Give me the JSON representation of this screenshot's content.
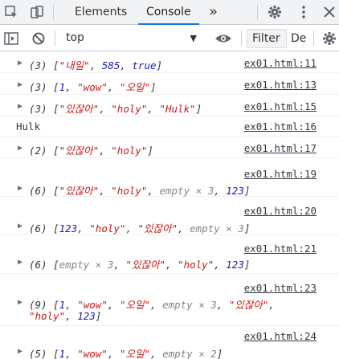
{
  "tabbar": {
    "tabs": [
      "Elements",
      "Console"
    ],
    "active_tab": "Console",
    "more_label": "»"
  },
  "toolbar": {
    "context": "top",
    "filter_placeholder": "Filter",
    "levels_label": "De"
  },
  "messages": [
    {
      "source": "ex01.html:11",
      "count": "(3)",
      "parts": [
        "[",
        "\"내일\"",
        ", ",
        "585",
        ", ",
        "true",
        "]"
      ]
    },
    {
      "source": "ex01.html:13",
      "count": "(3)",
      "parts": [
        "[",
        "1",
        ", ",
        "\"wow\"",
        ", ",
        "\"오일\"",
        "]"
      ]
    },
    {
      "source": "ex01.html:15",
      "count": "(3)",
      "parts": [
        "[",
        "\"있잖아\"",
        ", ",
        "\"holy\"",
        ", ",
        "\"Hulk\"",
        "]"
      ]
    },
    {
      "source": "ex01.html:16",
      "text": "Hulk"
    },
    {
      "source": "ex01.html:17",
      "count": "(2)",
      "parts": [
        "[",
        "\"있잖아\"",
        ", ",
        "\"holy\"",
        "]"
      ]
    },
    {
      "source": "ex01.html:19",
      "count": "(6)",
      "parts": [
        "[",
        "\"있잖아\"",
        ", ",
        "\"holy\"",
        ", ",
        "empty × 3",
        ", ",
        "123",
        "]"
      ]
    },
    {
      "source": "ex01.html:20",
      "count": "(6)",
      "parts": [
        "[",
        "123",
        ", ",
        "\"holy\"",
        ", ",
        "\"있잖아\"",
        ", ",
        "empty × 3",
        "]"
      ]
    },
    {
      "source": "ex01.html:21",
      "count": "(6)",
      "parts": [
        "[",
        "empty × 3",
        ", ",
        "\"있잖아\"",
        ", ",
        "\"holy\"",
        ", ",
        "123",
        "]"
      ]
    },
    {
      "source": "ex01.html:23",
      "count": "(9)",
      "parts": [
        "[",
        "1",
        ", ",
        "\"wow\"",
        ", ",
        "\"오일\"",
        ", ",
        "empty × 3",
        ", ",
        "\"있잖아\"",
        ","
      ],
      "parts2": [
        "\"holy\"",
        ", ",
        "123",
        "]"
      ]
    },
    {
      "source": "ex01.html:24",
      "count": "(5)",
      "parts": [
        "[",
        "1",
        ", ",
        "\"wow\"",
        ", ",
        "\"오일\"",
        ", ",
        "empty × 2",
        "]"
      ]
    }
  ],
  "colors": {
    "string": "#c41a16",
    "number": "#1a1aa6",
    "accent": "#1a73e8"
  }
}
